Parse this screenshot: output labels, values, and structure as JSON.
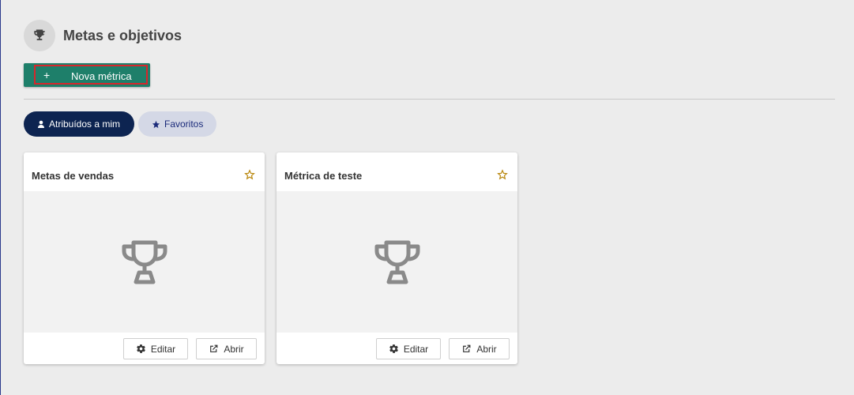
{
  "header": {
    "title": "Metas e objetivos",
    "icon": "trophy-icon"
  },
  "toolbar": {
    "new_metric_label": "Nova métrica",
    "new_metric_icon": "plus-icon",
    "plus_glyph": "+"
  },
  "filters": {
    "assigned_label": "Atribuídos a mim",
    "assigned_icon": "person-icon",
    "favorites_label": "Favoritos",
    "favorites_icon": "star-icon"
  },
  "cards": [
    {
      "title": "Metas de vendas",
      "edit_label": "Editar",
      "open_label": "Abrir",
      "favorite": false
    },
    {
      "title": "Métrica de teste",
      "edit_label": "Editar",
      "open_label": "Abrir",
      "favorite": false
    }
  ],
  "colors": {
    "primary": "#1e7f6a",
    "highlight_border": "#d7262b",
    "pill_active": "#0d2451",
    "pill_inactive": "#d4d8e6",
    "star": "#b8860b",
    "trophy": "#8a8a8a"
  }
}
